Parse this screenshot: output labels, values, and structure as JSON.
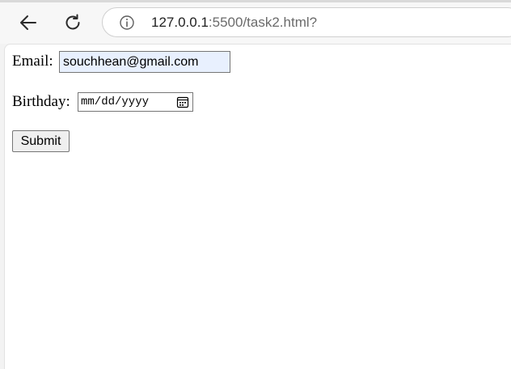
{
  "browser": {
    "url_host": "127.0.0.1",
    "url_rest": ":5500/task2.html?"
  },
  "form": {
    "email_label": "Email:",
    "email_value": "souchhean@gmail.com",
    "birthday_label": "Birthday:",
    "birthday_placeholder": "mm/dd/yyyy",
    "submit_label": "Submit"
  },
  "icons": [
    "back-arrow-icon",
    "reload-icon",
    "info-icon",
    "calendar-icon"
  ],
  "colors": {
    "email_autofill_bg": "#e8f0fe",
    "button_bg": "#efefef",
    "toolbar_bg": "#f7f7f7"
  }
}
